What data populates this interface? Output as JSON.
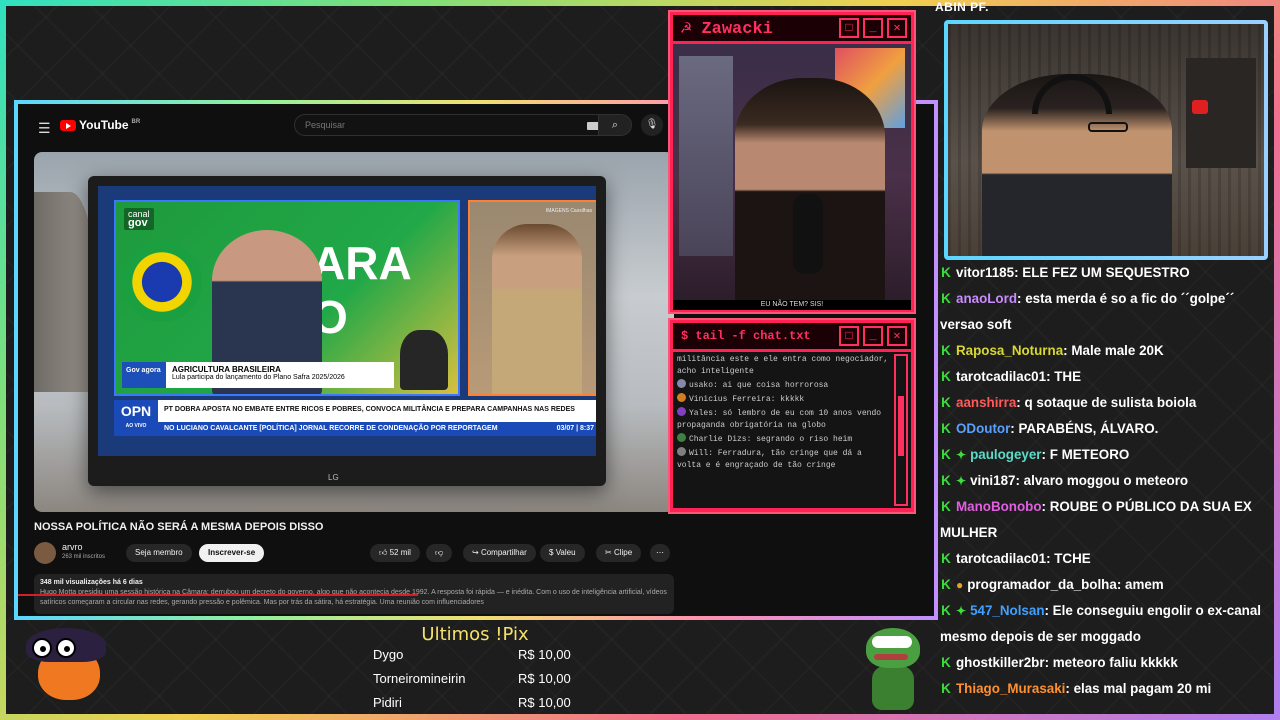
{
  "youtube": {
    "logo": "YouTube",
    "logo_sup": "BR",
    "search_placeholder": "Pesquisar",
    "video": {
      "canal_gov": "canal",
      "canal_gov2": "gov",
      "big_text": "ARA O",
      "imagens": "IMAGENS Cassilhas",
      "gov_agora": "Gov agora",
      "lower_title": "AGRICULTURA BRASILEIRA",
      "lower_sub": "Lula participa do lançamento do Plano Safra 2025/2026",
      "opn": "OPN",
      "ao_vivo": "AO VIVO",
      "ticker_top": "PT DOBRA APOSTA NO EMBATE ENTRE RICOS E POBRES, CONVOCA MILITÂNCIA E PREPARA CAMPANHAS NAS REDES",
      "ticker_bottom": "NO LUCIANO CAVALCANTE  [POLÍTICA] JORNAL RECORRE DE CONDENAÇÃO POR REPORTAGEM",
      "ticker_time": "03/07 | 8:37",
      "tv_brand": "LG"
    },
    "title": "NOSSA POLÍTICA NÃO SERÁ A MESMA DEPOIS DISSO",
    "channel": "arvro",
    "subscribers": "263 mil inscritos",
    "join": "Seja membro",
    "subscribe": "Inscrever-se",
    "likes": "52 mil",
    "share": "Compartilhar",
    "thanks": "Valeu",
    "clip": "Clipe",
    "more": "⋯",
    "views": "348 mil visualizações  há 6 dias",
    "description": "Hugo Motta presidiu uma sessão histórica na Câmara: derrubou um decreto do governo, algo que não acontecia desde 1992. A resposta foi rápida — e inédita. Com o uso de inteligência artificial, vídeos satíricos começaram a circular nas redes, gerando pressão e polêmica. Mas por trás da sátira, há estratégia. Uma reunião com influenciadores"
  },
  "zawacki": {
    "title": "Zawacki",
    "caption": "EU NÃO TEM? SIS!"
  },
  "tail": {
    "title": "$ tail -f chat.txt",
    "lines": [
      {
        "user": "",
        "text": "militância este e ele entra como negociador, acho inteligente",
        "color": "#888888"
      },
      {
        "user": "usako",
        "text": ": ai que coisa horrorosa",
        "color": "#8888aa"
      },
      {
        "user": "Vinicius Ferreira",
        "text": ": kkkkk",
        "color": "#d08020"
      },
      {
        "user": "Yales",
        "text": ": só lembro de eu com 10 anos vendo propaganda obrigatória na globo",
        "color": "#8040c0"
      },
      {
        "user": "Charlie Dizs",
        "text": ": segrando o riso heim",
        "color": "#408040"
      },
      {
        "user": "Will",
        "text": ": Ferradura, tão cringe que dá a volta e é engraçado de tão cringe",
        "color": "#808080"
      }
    ]
  },
  "streamer": {
    "name": "ABIN PF."
  },
  "chat": [
    {
      "badge": "K",
      "user": "vitor1185",
      "color": "#ffffff",
      "text": ": ELE FEZ UM SEQUESTRO"
    },
    {
      "badge": "K",
      "user": "anaoLord",
      "color": "#c88cff",
      "text": ": esta merda é so a fic do ´´golpe´´ versao soft"
    },
    {
      "badge": "K",
      "user": "Raposa_Noturna",
      "color": "#d8d830",
      "text": ": Male male 20K"
    },
    {
      "badge": "K",
      "user": "tarotcadilac01",
      "color": "#ffffff",
      "text": ": THE"
    },
    {
      "badge": "K",
      "user": "aanshirra",
      "color": "#ff5a5a",
      "text": ": q sotaque de sulista boiola"
    },
    {
      "badge": "K",
      "user": "ODoutor",
      "color": "#5aa0ff",
      "text": ": PARABÉNS, ÁLVARO."
    },
    {
      "badge": "K",
      "badge2": "✦",
      "badge2_color": "#3cdd3c",
      "user": "paulogeyer",
      "color": "#5adcc8",
      "text": ": F METEORO"
    },
    {
      "badge": "K",
      "badge2": "✦",
      "badge2_color": "#3cdd3c",
      "user": "vini187",
      "color": "#ffffff",
      "text": ": alvaro moggou o meteoro"
    },
    {
      "badge": "K",
      "user": "ManoBonobo",
      "color": "#e060e0",
      "text": ": ROUBE O PÚBLICO DA SUA EX MULHER"
    },
    {
      "badge": "K",
      "user": "tarotcadilac01",
      "color": "#ffffff",
      "text": ": TCHE"
    },
    {
      "badge": "K",
      "badge2": "●",
      "badge2_color": "#f0a020",
      "user": "programador_da_bolha",
      "color": "#ffffff",
      "text": ": amem"
    },
    {
      "badge": "K",
      "badge2": "✦",
      "badge2_color": "#3cdd3c",
      "user": "547_Nolsan",
      "color": "#40a0ff",
      "text": ": Ele conseguiu engolir o ex-canal mesmo depois de ser moggado"
    },
    {
      "badge": "K",
      "user": "ghostkiller2br",
      "color": "#ffffff",
      "text": ": meteoro faliu kkkkk"
    },
    {
      "badge": "K",
      "user": "Thiago_Murasaki",
      "color": "#ff9030",
      "text": ": elas mal pagam 20 mi"
    }
  ],
  "pix": {
    "title": "Ultimos !Pix",
    "rows": [
      {
        "name": "Dygo",
        "amount": "R$ 10,00"
      },
      {
        "name": "Torneiromineirin",
        "amount": "R$ 10,00"
      },
      {
        "name": "Pidiri",
        "amount": "R$ 10,00"
      }
    ]
  }
}
